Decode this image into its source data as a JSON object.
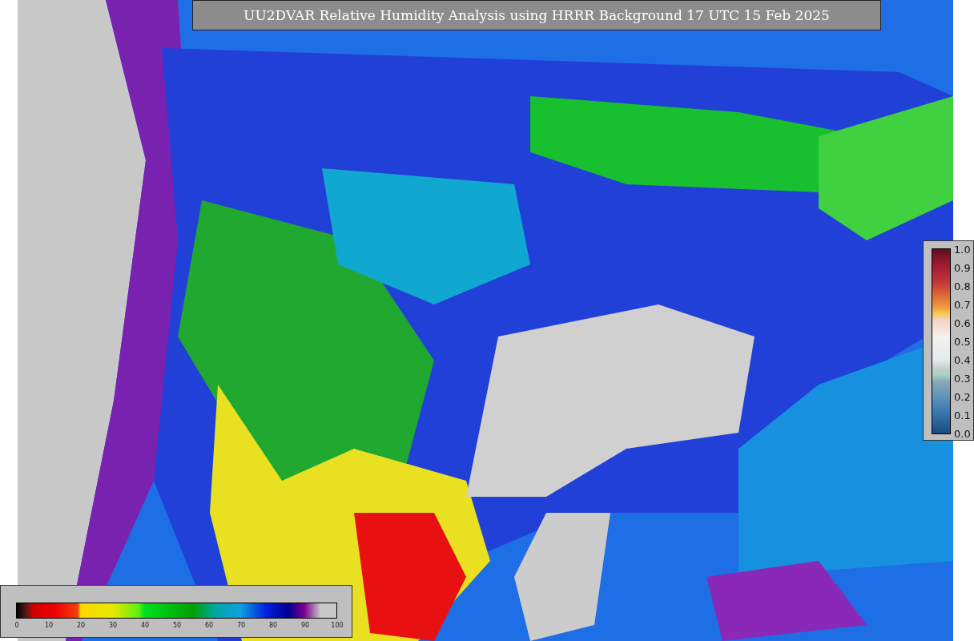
{
  "title": "UU2DVAR Relative Humidity Analysis using HRRR Background 17 UTC 15 Feb 2025",
  "field_colorbar": {
    "ticks": [
      "0",
      "10",
      "20",
      "30",
      "40",
      "50",
      "60",
      "70",
      "80",
      "90",
      "100"
    ]
  },
  "observation_colorbar": {
    "ticks": [
      "1.0",
      "0.9",
      "0.8",
      "0.7",
      "0.6",
      "0.5",
      "0.4",
      "0.3",
      "0.2",
      "0.1",
      "0.0"
    ]
  }
}
